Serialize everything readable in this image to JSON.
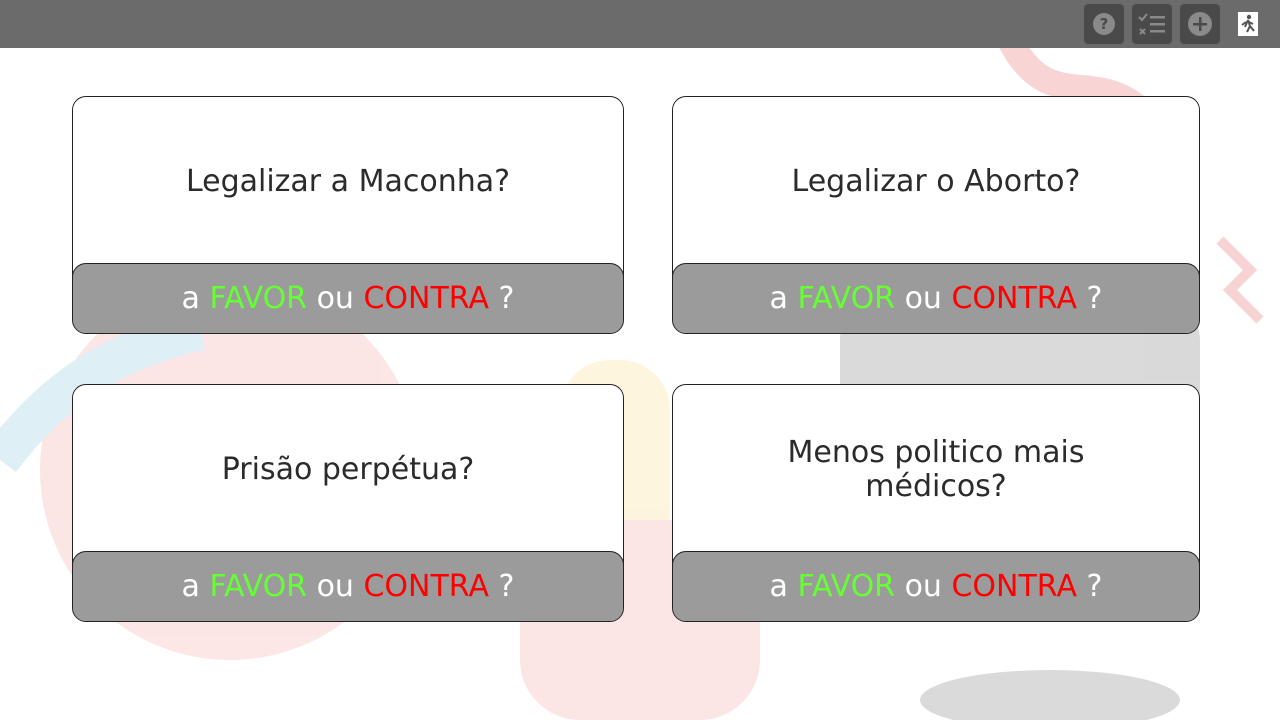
{
  "toolbar": {
    "buttons": [
      {
        "icon": "help-icon"
      },
      {
        "icon": "checklist-icon"
      },
      {
        "icon": "add-icon"
      },
      {
        "icon": "exit-icon"
      }
    ]
  },
  "cards": [
    {
      "question": "Legalizar a Maconha?",
      "prefix": "a ",
      "favor": "FAVOR",
      "middle": " ou ",
      "contra": "CONTRA",
      "suffix": " ?"
    },
    {
      "question": "Legalizar o Aborto?",
      "prefix": "a ",
      "favor": "FAVOR",
      "middle": " ou ",
      "contra": "CONTRA",
      "suffix": " ?"
    },
    {
      "question": "Prisão perpétua?",
      "prefix": "a ",
      "favor": "FAVOR",
      "middle": " ou ",
      "contra": "CONTRA",
      "suffix": " ?"
    },
    {
      "question": "Menos politico mais médicos?",
      "prefix": "a ",
      "favor": "FAVOR",
      "middle": " ou ",
      "contra": "CONTRA",
      "suffix": " ?"
    }
  ],
  "colors": {
    "favor": "#66ff33",
    "contra": "#ff0000",
    "topbar": "#6b6b6b",
    "bar": "#9b9b9b"
  }
}
